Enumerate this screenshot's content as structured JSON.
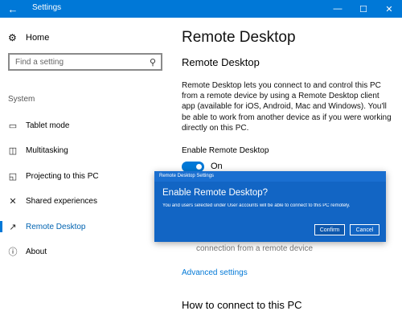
{
  "window": {
    "title": "Settings",
    "back_icon": "back-arrow-icon",
    "min_glyph": "—",
    "max_glyph": "☐",
    "close_glyph": "✕"
  },
  "sidebar": {
    "home_label": "Home",
    "search_placeholder": "Find a setting",
    "group_label": "System",
    "items": [
      {
        "label": "Tablet mode",
        "icon": "tablet-icon"
      },
      {
        "label": "Multitasking",
        "icon": "multitasking-icon"
      },
      {
        "label": "Projecting to this PC",
        "icon": "projecting-icon"
      },
      {
        "label": "Shared experiences",
        "icon": "shared-experiences-icon"
      },
      {
        "label": "Remote Desktop",
        "icon": "remote-desktop-icon",
        "active": true
      },
      {
        "label": "About",
        "icon": "info-icon"
      }
    ]
  },
  "content": {
    "page_title": "Remote Desktop",
    "section_title": "Remote Desktop",
    "description": "Remote Desktop lets you connect to and control this PC from a remote device by using a Remote Desktop client app (available for iOS, Android, Mac and Windows). You'll be able to work from another device as if you were working directly on this PC.",
    "enable_label": "Enable Remote Desktop",
    "toggle_state": "On",
    "partial_text": "connection from a remote device",
    "advanced_link": "Advanced settings",
    "bottom_heading": "How to connect to this PC"
  },
  "dialog": {
    "title": "Remote Desktop Settings",
    "heading": "Enable Remote Desktop?",
    "message": "You and users selected under User accounts will be able to connect to this PC remotely.",
    "confirm_label": "Confirm",
    "cancel_label": "Cancel"
  },
  "colors": {
    "accent": "#0078d7",
    "dialog_bg": "#1265c4"
  }
}
